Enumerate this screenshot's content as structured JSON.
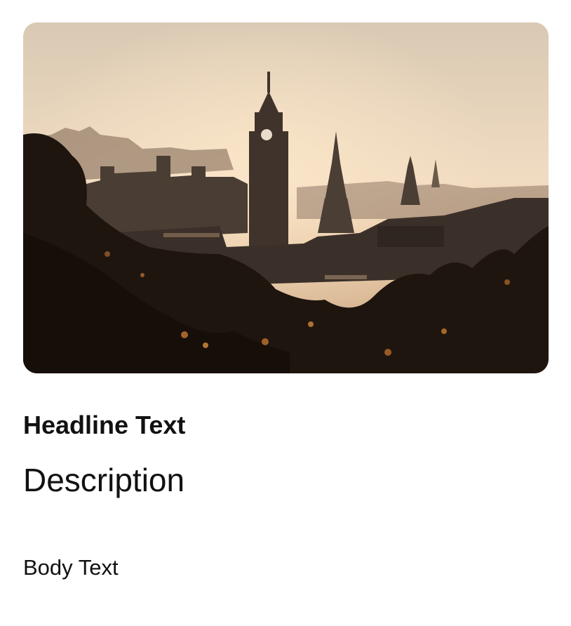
{
  "card": {
    "image": {
      "description": "City skyline at sunset with clock tower and spires",
      "colors": {
        "sky_top": "#d8c8b3",
        "sky_bottom": "#f2d9bd",
        "buildings": "#3a2f28",
        "foliage": "#1e140e",
        "highlight": "#c97a2e"
      }
    },
    "headline": "Headline Text",
    "description": "Description",
    "body": "Body Text"
  }
}
